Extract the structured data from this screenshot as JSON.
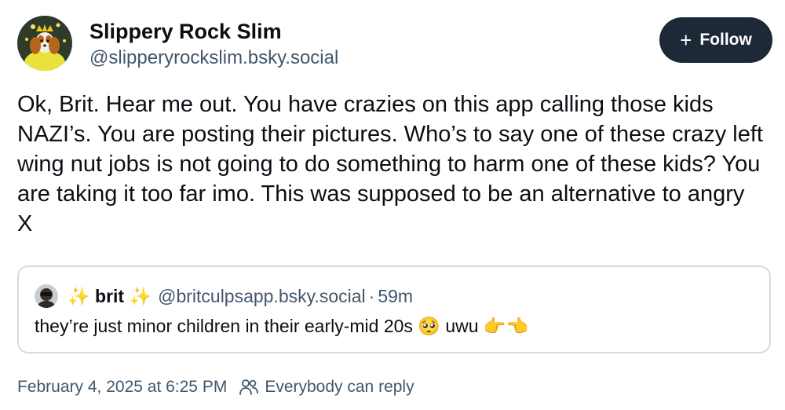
{
  "author": {
    "display_name": "Slippery Rock Slim",
    "handle": "@slipperyrockslim.bsky.social",
    "avatar_icon": "avatar-dog-in-yellow"
  },
  "follow_button": {
    "icon": "plus-icon",
    "plus_glyph": "+",
    "label": "Follow"
  },
  "post": {
    "text": "Ok, Brit. Hear me out. You have crazies on this app calling those kids NAZI’s. You are posting their pictures. Who’s to say one of these crazy left wing nut jobs is not going to do something to harm one of these kids? You are taking it too far imo. This was supposed to be an alternative to angry X"
  },
  "quoted_post": {
    "display_name": "✨ brit ✨",
    "handle": "@britculpsapp.bsky.social",
    "separator": "·",
    "time_ago": "59m",
    "text": "they’re just minor children in their early-mid 20s 🥺 uwu 👉👈"
  },
  "footer": {
    "timestamp": "February 4, 2025 at 6:25 PM",
    "reply_setting_icon": "people-icon",
    "reply_setting": "Everybody can reply"
  },
  "colors": {
    "text_primary": "#0b0f14",
    "text_secondary": "#42576c",
    "follow_bg": "#1e2938",
    "quote_border": "#d4dbe2"
  }
}
